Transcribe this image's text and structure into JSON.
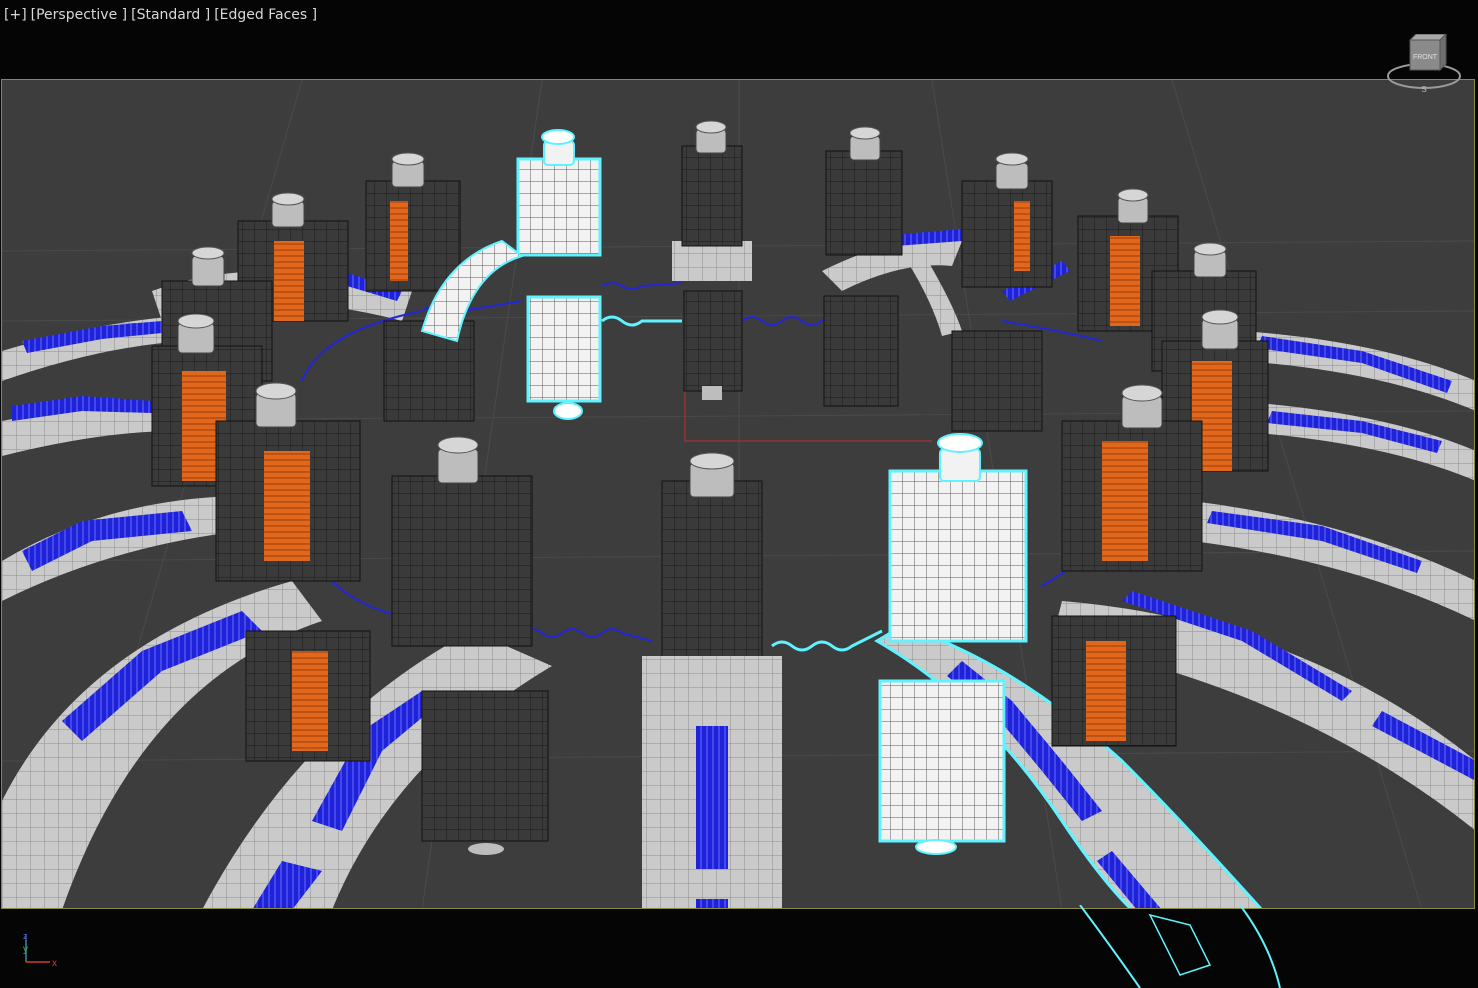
{
  "viewport": {
    "labels": [
      "[+]",
      "[Perspective ]",
      "[Standard ]",
      "[Edged Faces ]"
    ]
  },
  "viewcube": {
    "face_label": "FRONT",
    "compass_letter": "S"
  },
  "axis_tripod": {
    "x": "x",
    "y": "y",
    "z": "z"
  },
  "colors": {
    "viewport_bg": "#3d3d3d",
    "active_border": "#8f8a3a",
    "selection": "#5ff3ff",
    "path_blue": "#1e22d8",
    "coil_orange": "#e0671c",
    "mesh_dark": "#3a3a3a",
    "mesh_light": "#c9c9c9"
  }
}
